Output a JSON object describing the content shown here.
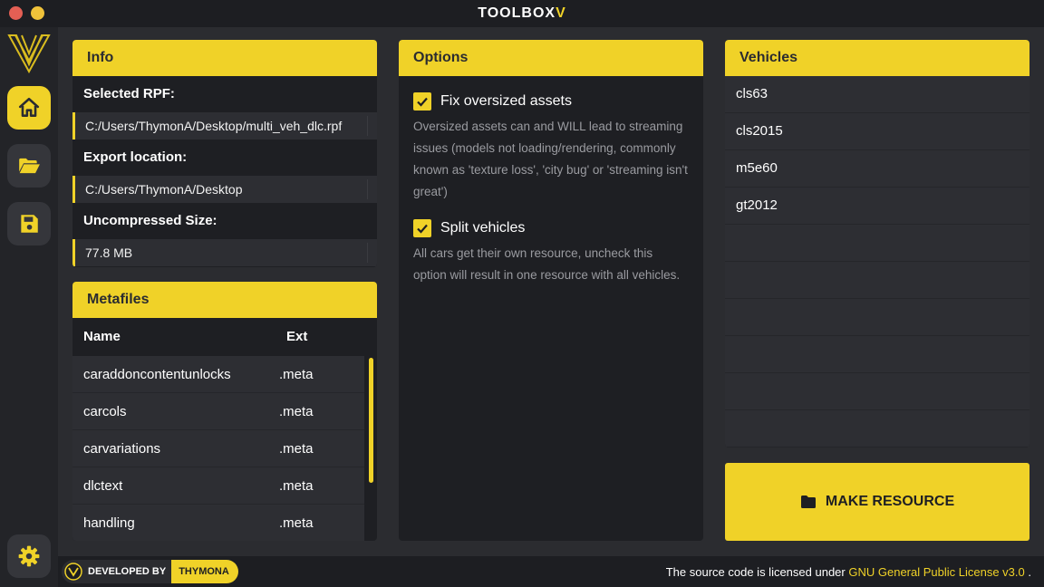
{
  "window": {
    "title": "TOOLBOX",
    "title_accent": "V"
  },
  "colors": {
    "accent": "#f0d228",
    "background": "#2b2c30",
    "panel": "#1e1f23",
    "row": "#2d2e33"
  },
  "sidebar": {
    "items": [
      {
        "name": "home",
        "icon": "home-icon",
        "active": true
      },
      {
        "name": "open",
        "icon": "folder-open-icon",
        "active": false
      },
      {
        "name": "save",
        "icon": "save-icon",
        "active": false
      },
      {
        "name": "settings",
        "icon": "gear-icon",
        "active": false
      }
    ]
  },
  "info": {
    "header": "Info",
    "selected_rpf_label": "Selected RPF:",
    "selected_rpf_value": "C:/Users/ThymonA/Desktop/multi_veh_dlc.rpf",
    "export_label": "Export location:",
    "export_value": "C:/Users/ThymonA/Desktop",
    "size_label": "Uncompressed Size:",
    "size_value": "77.8 MB"
  },
  "metafiles": {
    "header": "Metafiles",
    "columns": [
      "Name",
      "Ext"
    ],
    "rows": [
      {
        "name": "caraddoncontentunlocks",
        "ext": ".meta"
      },
      {
        "name": "carcols",
        "ext": ".meta"
      },
      {
        "name": "carvariations",
        "ext": ".meta"
      },
      {
        "name": "dlctext",
        "ext": ".meta"
      },
      {
        "name": "handling",
        "ext": ".meta"
      }
    ]
  },
  "options": {
    "header": "Options",
    "items": [
      {
        "label": "Fix oversized assets",
        "checked": true,
        "description": "Oversized assets can and WILL lead to streaming issues (models not loading/rendering, commonly known as 'texture loss', 'city bug' or 'streaming isn't great')"
      },
      {
        "label": "Split vehicles",
        "checked": true,
        "description": "All cars get their own resource, uncheck this option will result in one resource with all vehicles."
      }
    ]
  },
  "vehicles": {
    "header": "Vehicles",
    "items": [
      "cls63",
      "cls2015",
      "m5e60",
      "gt2012",
      "",
      "",
      "",
      "",
      "",
      ""
    ]
  },
  "actions": {
    "make_resource_label": "MAKE RESOURCE"
  },
  "footer": {
    "developed_by": "DEVELOPED BY",
    "developer": "THYMONA",
    "license_text": "The source code is licensed under",
    "license_link": "GNU General Public License v3.0",
    "license_suffix": "."
  }
}
